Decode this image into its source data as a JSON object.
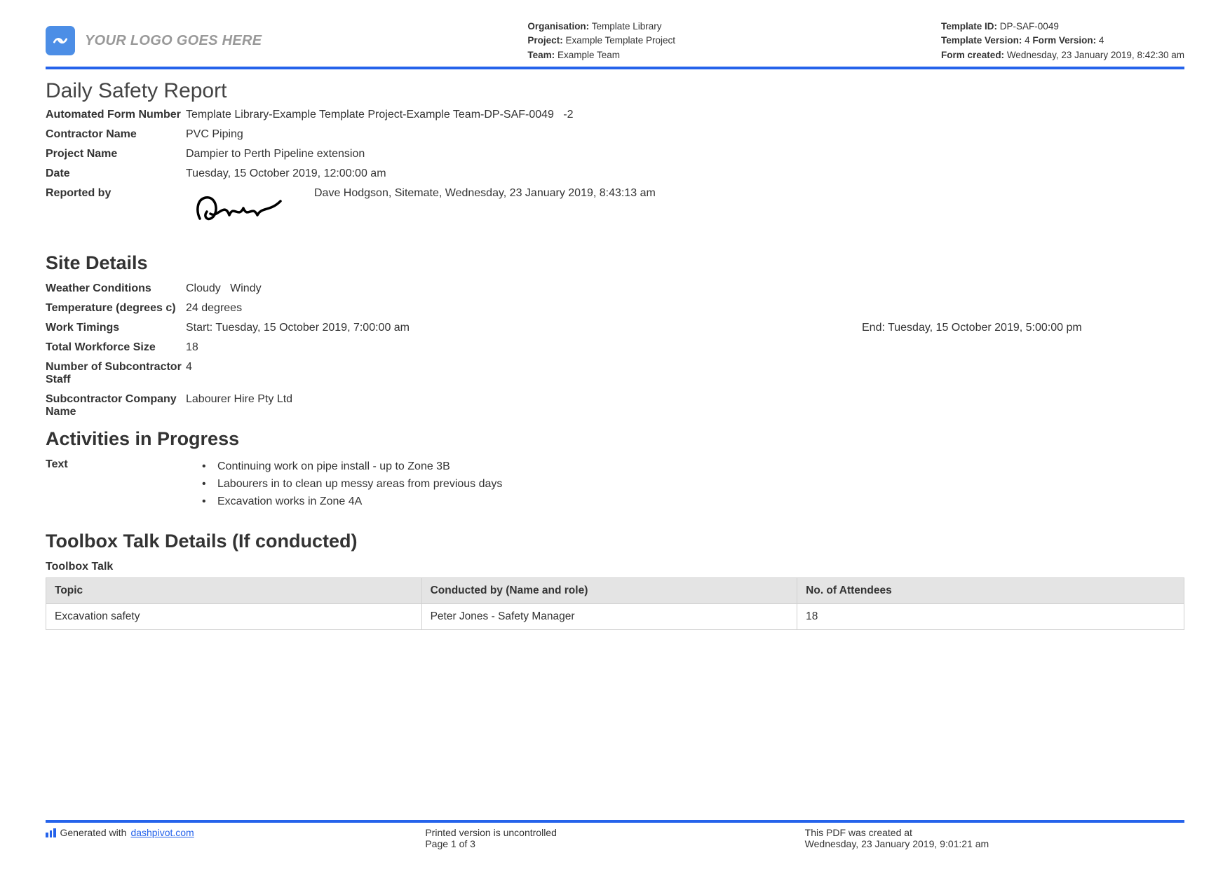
{
  "header": {
    "logo_text": "YOUR LOGO GOES HERE",
    "org_label": "Organisation:",
    "org_value": " Template Library",
    "project_label": "Project:",
    "project_value": " Example Template Project",
    "team_label": "Team:",
    "team_value": " Example Team",
    "template_id_label": "Template ID:",
    "template_id_value": " DP-SAF-0049",
    "template_version_label": "Template Version:",
    "template_version_value": " 4 ",
    "form_version_label": "Form Version:",
    "form_version_value": " 4",
    "form_created_label": "Form created:",
    "form_created_value": " Wednesday, 23 January 2019, 8:42:30 am"
  },
  "title": "Daily Safety Report",
  "form": {
    "afn_label": "Automated Form Number",
    "afn_value": "Template Library-Example Template Project-Example Team-DP-SAF-0049   -2",
    "contractor_label": "Contractor Name",
    "contractor_value": "PVC Piping",
    "project_label": "Project Name",
    "project_value": "Dampier to Perth Pipeline extension",
    "date_label": "Date",
    "date_value": "Tuesday, 15 October 2019, 12:00:00 am",
    "reported_label": "Reported by",
    "reported_value": "Dave Hodgson, Sitemate, Wednesday, 23 January 2019, 8:43:13 am"
  },
  "site": {
    "heading": "Site Details",
    "weather_label": "Weather Conditions",
    "weather_value": "Cloudy   Windy",
    "temp_label": "Temperature (degrees c)",
    "temp_value": "24 degrees",
    "timings_label": "Work Timings",
    "timings_start": "Start: Tuesday, 15 October 2019, 7:00:00 am",
    "timings_end": "End: Tuesday, 15 October 2019, 5:00:00 pm",
    "workforce_label": "Total Workforce Size",
    "workforce_value": "18",
    "subcount_label": "Number of Subcontractor Staff",
    "subcount_value": "4",
    "subco_label": "Subcontractor Company Name",
    "subco_value": "Labourer Hire Pty Ltd"
  },
  "activities": {
    "heading": "Activities in Progress",
    "label": "Text",
    "items": [
      "Continuing work on pipe install - up to Zone 3B",
      "Labourers in to clean up messy areas from previous days",
      "Excavation works in Zone 4A"
    ]
  },
  "toolbox": {
    "heading": "Toolbox Talk Details (If conducted)",
    "sublabel": "Toolbox Talk",
    "columns": [
      "Topic",
      "Conducted by (Name and role)",
      "No. of Attendees"
    ],
    "rows": [
      [
        "Excavation safety",
        "Peter Jones - Safety Manager",
        "18"
      ]
    ]
  },
  "footer": {
    "generated_prefix": "Generated with ",
    "generated_link": "dashpivot.com",
    "uncontrolled": "Printed version is uncontrolled",
    "page": "Page 1 of 3",
    "created_label": "This PDF was created at",
    "created_value": "Wednesday, 23 January 2019, 9:01:21 am"
  }
}
